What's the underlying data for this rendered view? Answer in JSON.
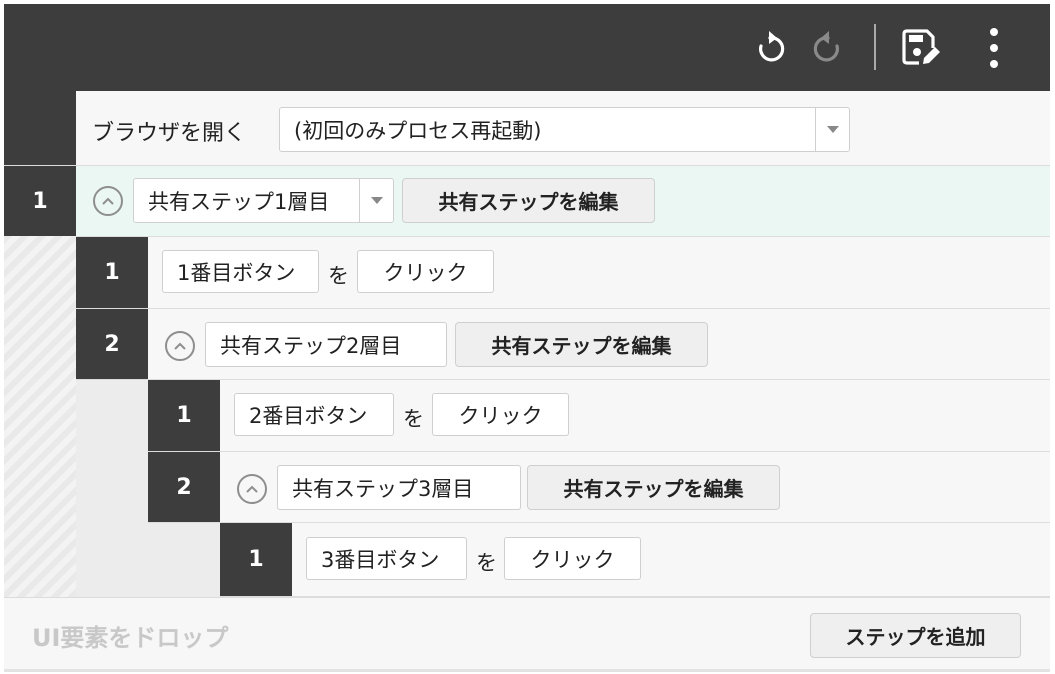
{
  "toolbar": {
    "undo_icon": "undo-icon",
    "redo_icon": "redo-icon",
    "save_edit_icon": "save-edit-icon",
    "more_icon": "more-vertical-icon"
  },
  "browser_step": {
    "label": "ブラウザを開く",
    "option": "(初回のみプロセス再起動)"
  },
  "steps": {
    "s1": {
      "number": "1",
      "shared_step": "共有ステップ1層目",
      "edit_label": "共有ステップを編集",
      "row_color": "#eaf7f3"
    },
    "s1_1": {
      "number": "1",
      "target": "1番目ボタン",
      "particle": "を",
      "action": "クリック"
    },
    "s1_2": {
      "number": "2",
      "shared_step": "共有ステップ2層目",
      "edit_label": "共有ステップを編集"
    },
    "s1_2_1": {
      "number": "1",
      "target": "2番目ボタン",
      "particle": "を",
      "action": "クリック"
    },
    "s1_2_2": {
      "number": "2",
      "shared_step": "共有ステップ3層目",
      "edit_label": "共有ステップを編集"
    },
    "s1_2_2_1": {
      "number": "1",
      "target": "3番目ボタン",
      "particle": "を",
      "action": "クリック"
    }
  },
  "footer": {
    "drop_hint": "UI要素をドロップ",
    "add_step_label": "ステップを追加"
  },
  "colors": {
    "dark": "#3d3d3d",
    "highlight_row": "#eaf7f3"
  }
}
